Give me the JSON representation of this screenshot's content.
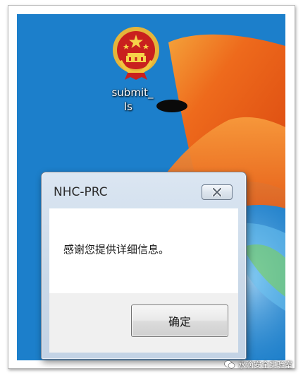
{
  "desktop": {
    "icon": {
      "label_line1": "submit_",
      "label_line2": "ls",
      "image": "national-emblem-icon"
    }
  },
  "dialog": {
    "title": "NHC-PRC",
    "message": "感谢您提供详细信息。",
    "ok_label": "确定",
    "close_icon": "close-x-icon"
  },
  "watermark": {
    "text": "水滴安全实验室"
  },
  "colors": {
    "desktop_blue": "#1a78c2",
    "wallpaper_orange": "#ef6a1a",
    "dialog_frame": "#c9d8e8"
  }
}
